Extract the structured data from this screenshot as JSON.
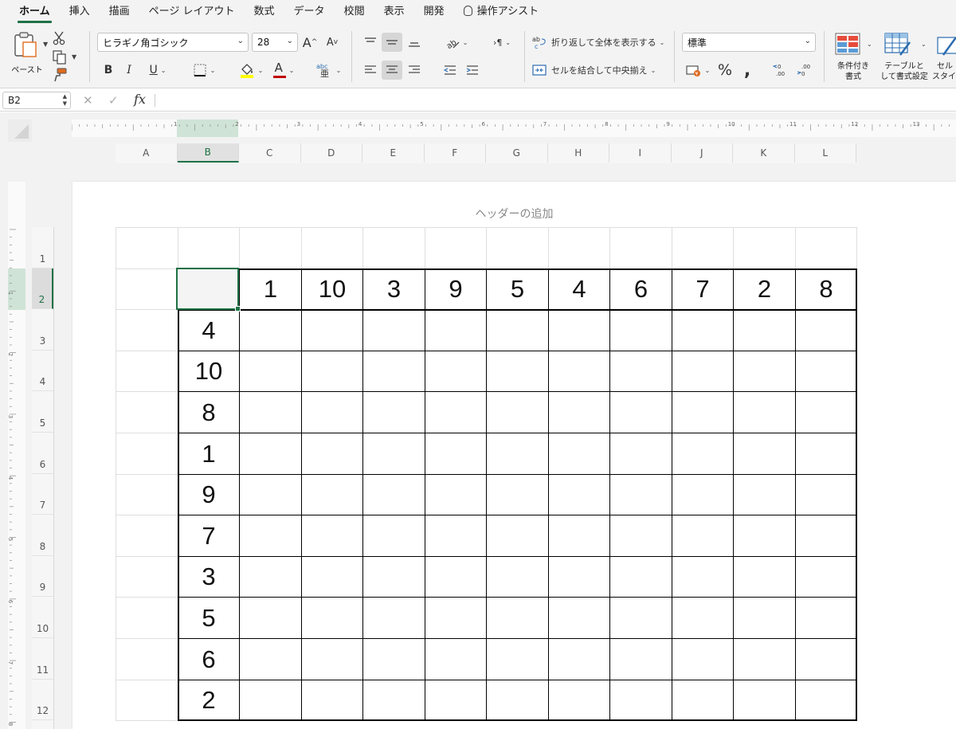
{
  "tabs": [
    {
      "label": "ホーム",
      "active": true
    },
    {
      "label": "挿入"
    },
    {
      "label": "描画"
    },
    {
      "label": "ページ レイアウト"
    },
    {
      "label": "数式"
    },
    {
      "label": "データ"
    },
    {
      "label": "校閲"
    },
    {
      "label": "表示"
    },
    {
      "label": "開発"
    },
    {
      "label": "操作アシスト"
    }
  ],
  "ribbon": {
    "paste_label": "ペースト",
    "font_name": "ヒラギノ角ゴシック",
    "font_size": "28",
    "grow_label": "A",
    "shrink_label": "A",
    "bold": "B",
    "italic": "I",
    "underline": "U",
    "font_color_letter": "A",
    "wrap_text_label": "折り返して全体を表示する",
    "merge_label": "セルを結合して中央揃え",
    "number_format": "標準",
    "percent": "%",
    "comma": ",",
    "cond_format_line1": "条件付き",
    "cond_format_line2": "書式",
    "table_format_line1": "テーブルと",
    "table_format_line2": "して書式設定",
    "cell_style_line1": "セル",
    "cell_style_line2": "スタイ",
    "accent_color": "#1e7145",
    "highlight_color": "#ffff00",
    "font_color": "#c00000"
  },
  "formula_bar": {
    "cell_ref": "B2",
    "fx": "fx",
    "value": ""
  },
  "sheet": {
    "header_hint": "ヘッダーの追加",
    "columns": [
      "A",
      "B",
      "C",
      "D",
      "E",
      "F",
      "G",
      "H",
      "I",
      "J",
      "K",
      "L"
    ],
    "selected_column": "B",
    "rows": [
      "1",
      "2",
      "3",
      "4",
      "5",
      "6",
      "7",
      "8",
      "9",
      "10",
      "11",
      "12"
    ],
    "selected_row": "2",
    "ruler_h": [
      "1",
      "2",
      "3",
      "4",
      "5",
      "6",
      "7",
      "8",
      "9",
      "10",
      "11",
      "12",
      "13"
    ],
    "ruler_v": [
      "1",
      "2",
      "3",
      "4",
      "5",
      "6",
      "7",
      "8"
    ],
    "top_values": [
      "1",
      "10",
      "3",
      "9",
      "5",
      "4",
      "6",
      "7",
      "2",
      "8"
    ],
    "left_values": [
      "4",
      "10",
      "8",
      "1",
      "9",
      "7",
      "3",
      "5",
      "6",
      "2"
    ]
  }
}
